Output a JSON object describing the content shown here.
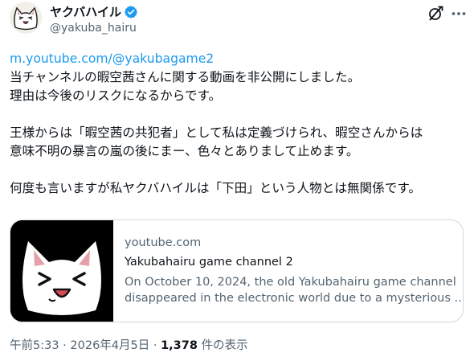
{
  "author": {
    "display_name": "ヤクバハイル",
    "handle": "@yakuba_hairu"
  },
  "tweet": {
    "link": "m.youtube.com/@yakubagame2",
    "lines": [
      "当チャンネルの暇空茜さんに関する動画を非公開にしました。",
      "理由は今後のリスクになるからです。",
      "王様からは「暇空茜の共犯者」として私は定義づけられ、暇空さんからは",
      "意味不明の暴言の嵐の後にまー、色々とありまして止めます。",
      "何度も言いますが私ヤクバハイルは「下田」という人物とは無関係です。"
    ]
  },
  "card": {
    "domain": "youtube.com",
    "title": "Yakubahairu game channel 2",
    "description_lines": [
      "On October 10, 2024, the old Yakubahairu game channel",
      "disappeared in the electronic world due to a mysterious ..."
    ]
  },
  "meta": {
    "time": "午前5:33",
    "separator": "·",
    "date": "2026年4月5日",
    "views_count": "1,378",
    "views_label": "件の表示"
  },
  "icons": {
    "verified": "verified-badge-icon",
    "grok": "grok-icon",
    "more": "more-icon"
  },
  "colors": {
    "accent": "#1d9bf0",
    "text": "#0f1419",
    "muted": "#536471",
    "border": "#cfd9de"
  }
}
